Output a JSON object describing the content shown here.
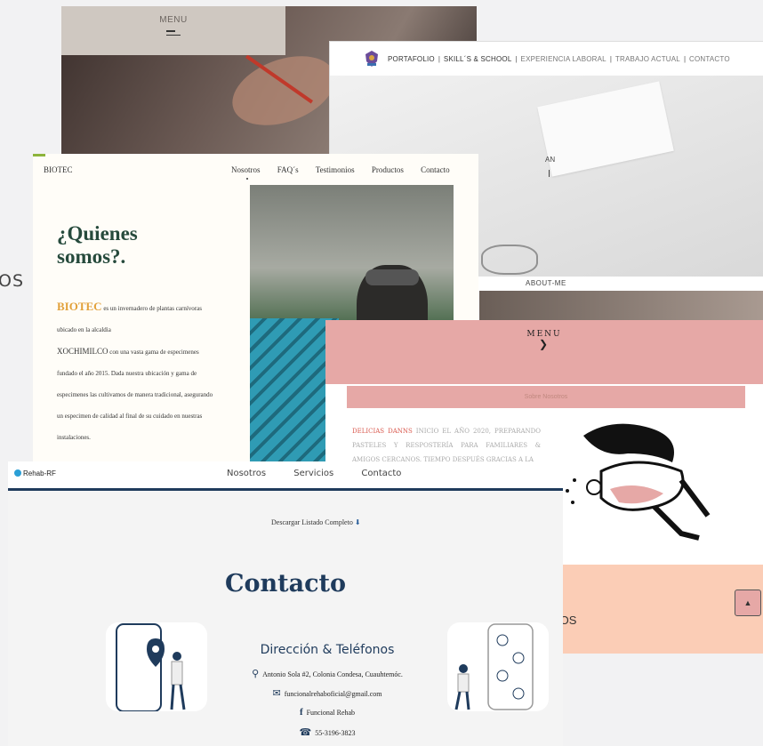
{
  "bg_text": "OS",
  "card1": {
    "menu_label": "MENU"
  },
  "card2": {
    "nav": [
      "PORTAFOLIO",
      "SKILL´S & SCHOOL",
      "EXPERIENCIA LABORAL",
      "TRABAJO ACTUAL",
      "CONTACTO"
    ],
    "hero_text": "AN",
    "about": "ABOUT-ME"
  },
  "card3": {
    "brand": "BIOTEC",
    "nav": [
      "Nosotros",
      "FAQ´s",
      "Testimonios",
      "Productos",
      "Contacto"
    ],
    "title_line1": "¿Quienes",
    "title_line2": "somos?.",
    "p_brand": "BIOTEC",
    "p1": " es un invernadero de plantas carnívoras ubicado en la alcaldia",
    "p_place": "XOCHIMILCO",
    "p2": " con una vasta gama de especimenes fundado el año 2015. Dada nuestra ubicación y gama de especimenes las cultivamos de manera tradicional, asegurando un especimen de calidad al final de su cuidado en nuestras instalaciones."
  },
  "card4": {
    "menu_label": "MENU",
    "sobre": "Sobre Nosotros",
    "brand": "DELICIAS DANNS",
    "text": " INICIO EL AÑO 2020, PREPARANDO PASTELES Y RESPOSTERÍA PARA FAMILIARES & AMIGOS CERCANOS. TIEMPO DESPUÉS GRACIAS A LA",
    "peach_text": "IOS",
    "up_icon": "chevron-up"
  },
  "card5": {
    "brand": "Rehab-RF",
    "nav": [
      "Nosotros",
      "Servicios",
      "Contacto"
    ],
    "download": "Descargar Listado Completo",
    "title": "Contacto",
    "dir_title": "Dirección & Teléfonos",
    "address": "Antonio Sola #2, Colonia Condesa, Cuauhtemóc.",
    "email": "funcionalrehaboficial@gmail.com",
    "facebook": "Funcional Rehab",
    "phone": "55-3196-3823"
  },
  "colors": {
    "navy": "#1f3b5c",
    "pink": "#e6a8a6",
    "peach": "#fbcdb6",
    "biotec_green": "#264a3c",
    "biotec_orange": "#e2a13b"
  }
}
